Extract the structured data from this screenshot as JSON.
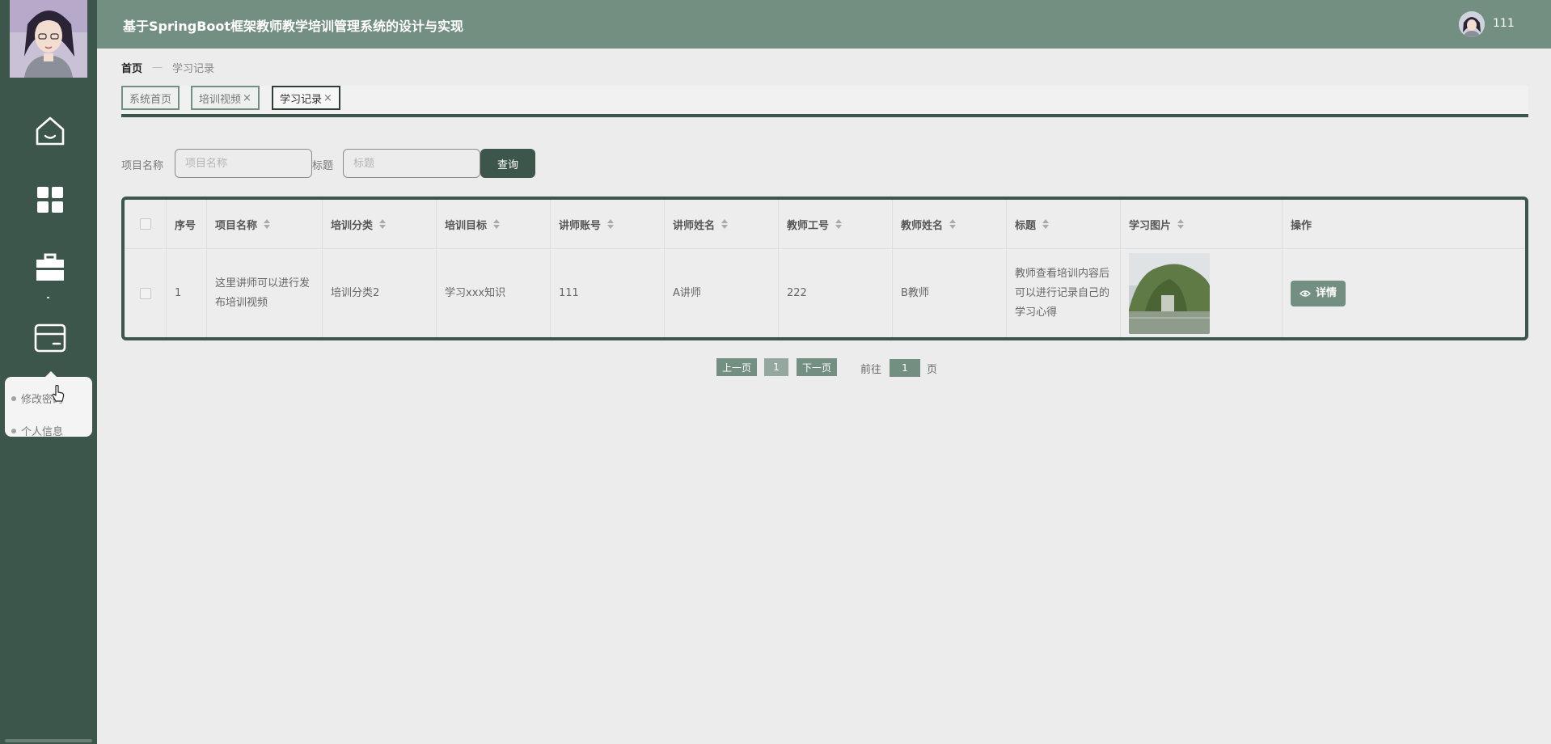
{
  "app": {
    "title": "基于SpringBoot框架教师教学培训管理系统的设计与实现",
    "user_name": "111"
  },
  "sidebar": {
    "icons": [
      "home-icon",
      "grid-icon",
      "briefcase-icon",
      "wallet-icon"
    ],
    "submenu": [
      {
        "label": "修改密码"
      },
      {
        "label": "个人信息"
      }
    ]
  },
  "breadcrumb": {
    "home": "首页",
    "separator": "—",
    "current": "学习记录"
  },
  "tabs": [
    {
      "label": "系统首页",
      "closable": false
    },
    {
      "label": "培训视频",
      "closable": true
    },
    {
      "label": "学习记录",
      "closable": true,
      "active": true
    }
  ],
  "tab_close": "×",
  "search": {
    "project_label": "项目名称",
    "project_placeholder": "项目名称",
    "title_label": "标题",
    "title_placeholder": "标题",
    "query_button": "查询"
  },
  "table": {
    "headers": [
      "序号",
      "项目名称",
      "培训分类",
      "培训目标",
      "讲师账号",
      "讲师姓名",
      "教师工号",
      "教师姓名",
      "标题",
      "学习图片",
      "操作"
    ],
    "rows": [
      {
        "index": "1",
        "project_name": "这里讲师可以进行发布培训视频",
        "category": "培训分类2",
        "goal": "学习xxx知识",
        "lecturer_account": "111",
        "lecturer_name": "A讲师",
        "teacher_id": "222",
        "teacher_name": "B教师",
        "title": "教师查看培训内容后可以进行记录自己的学习心得",
        "action": "详情"
      }
    ]
  },
  "pagination": {
    "prev": "上一页",
    "page": "1",
    "next": "下一页",
    "goto_label": "前往",
    "goto_value": "1",
    "page_suffix": "页"
  },
  "colors": {
    "sidebar": "#3d564c",
    "header": "#728f82",
    "background": "#ececec",
    "accent": "#728f82"
  }
}
